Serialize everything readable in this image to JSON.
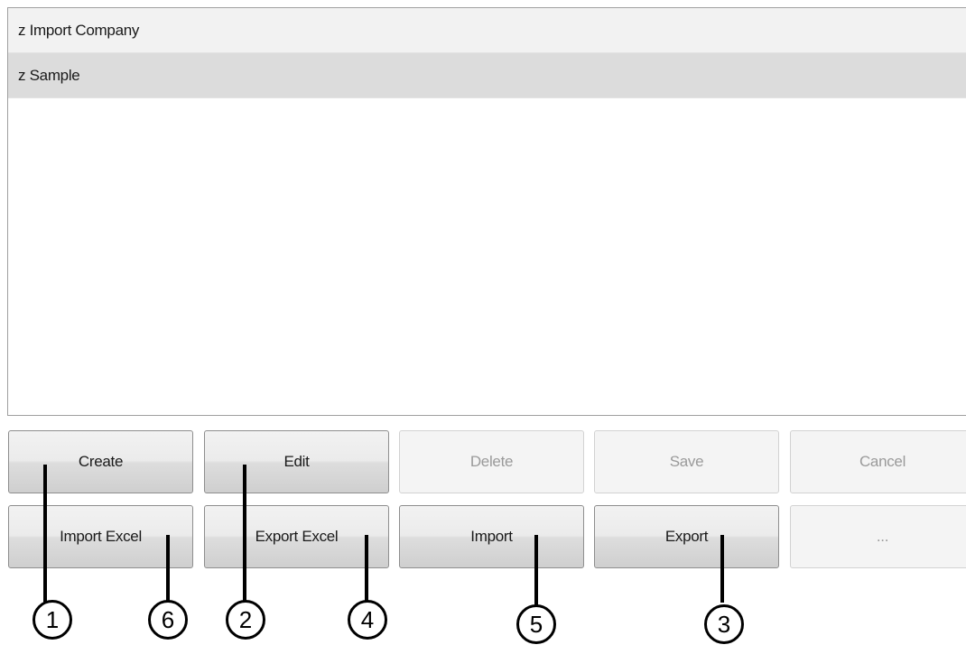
{
  "list": {
    "items": [
      "z Import Company",
      "z Sample"
    ]
  },
  "buttons": {
    "create": "Create",
    "edit": "Edit",
    "delete": "Delete",
    "save": "Save",
    "cancel": "Cancel",
    "import_excel": "Import Excel",
    "export_excel": "Export Excel",
    "import": "Import",
    "export": "Export",
    "more": "..."
  },
  "callouts": [
    "1",
    "6",
    "2",
    "4",
    "5",
    "3"
  ]
}
